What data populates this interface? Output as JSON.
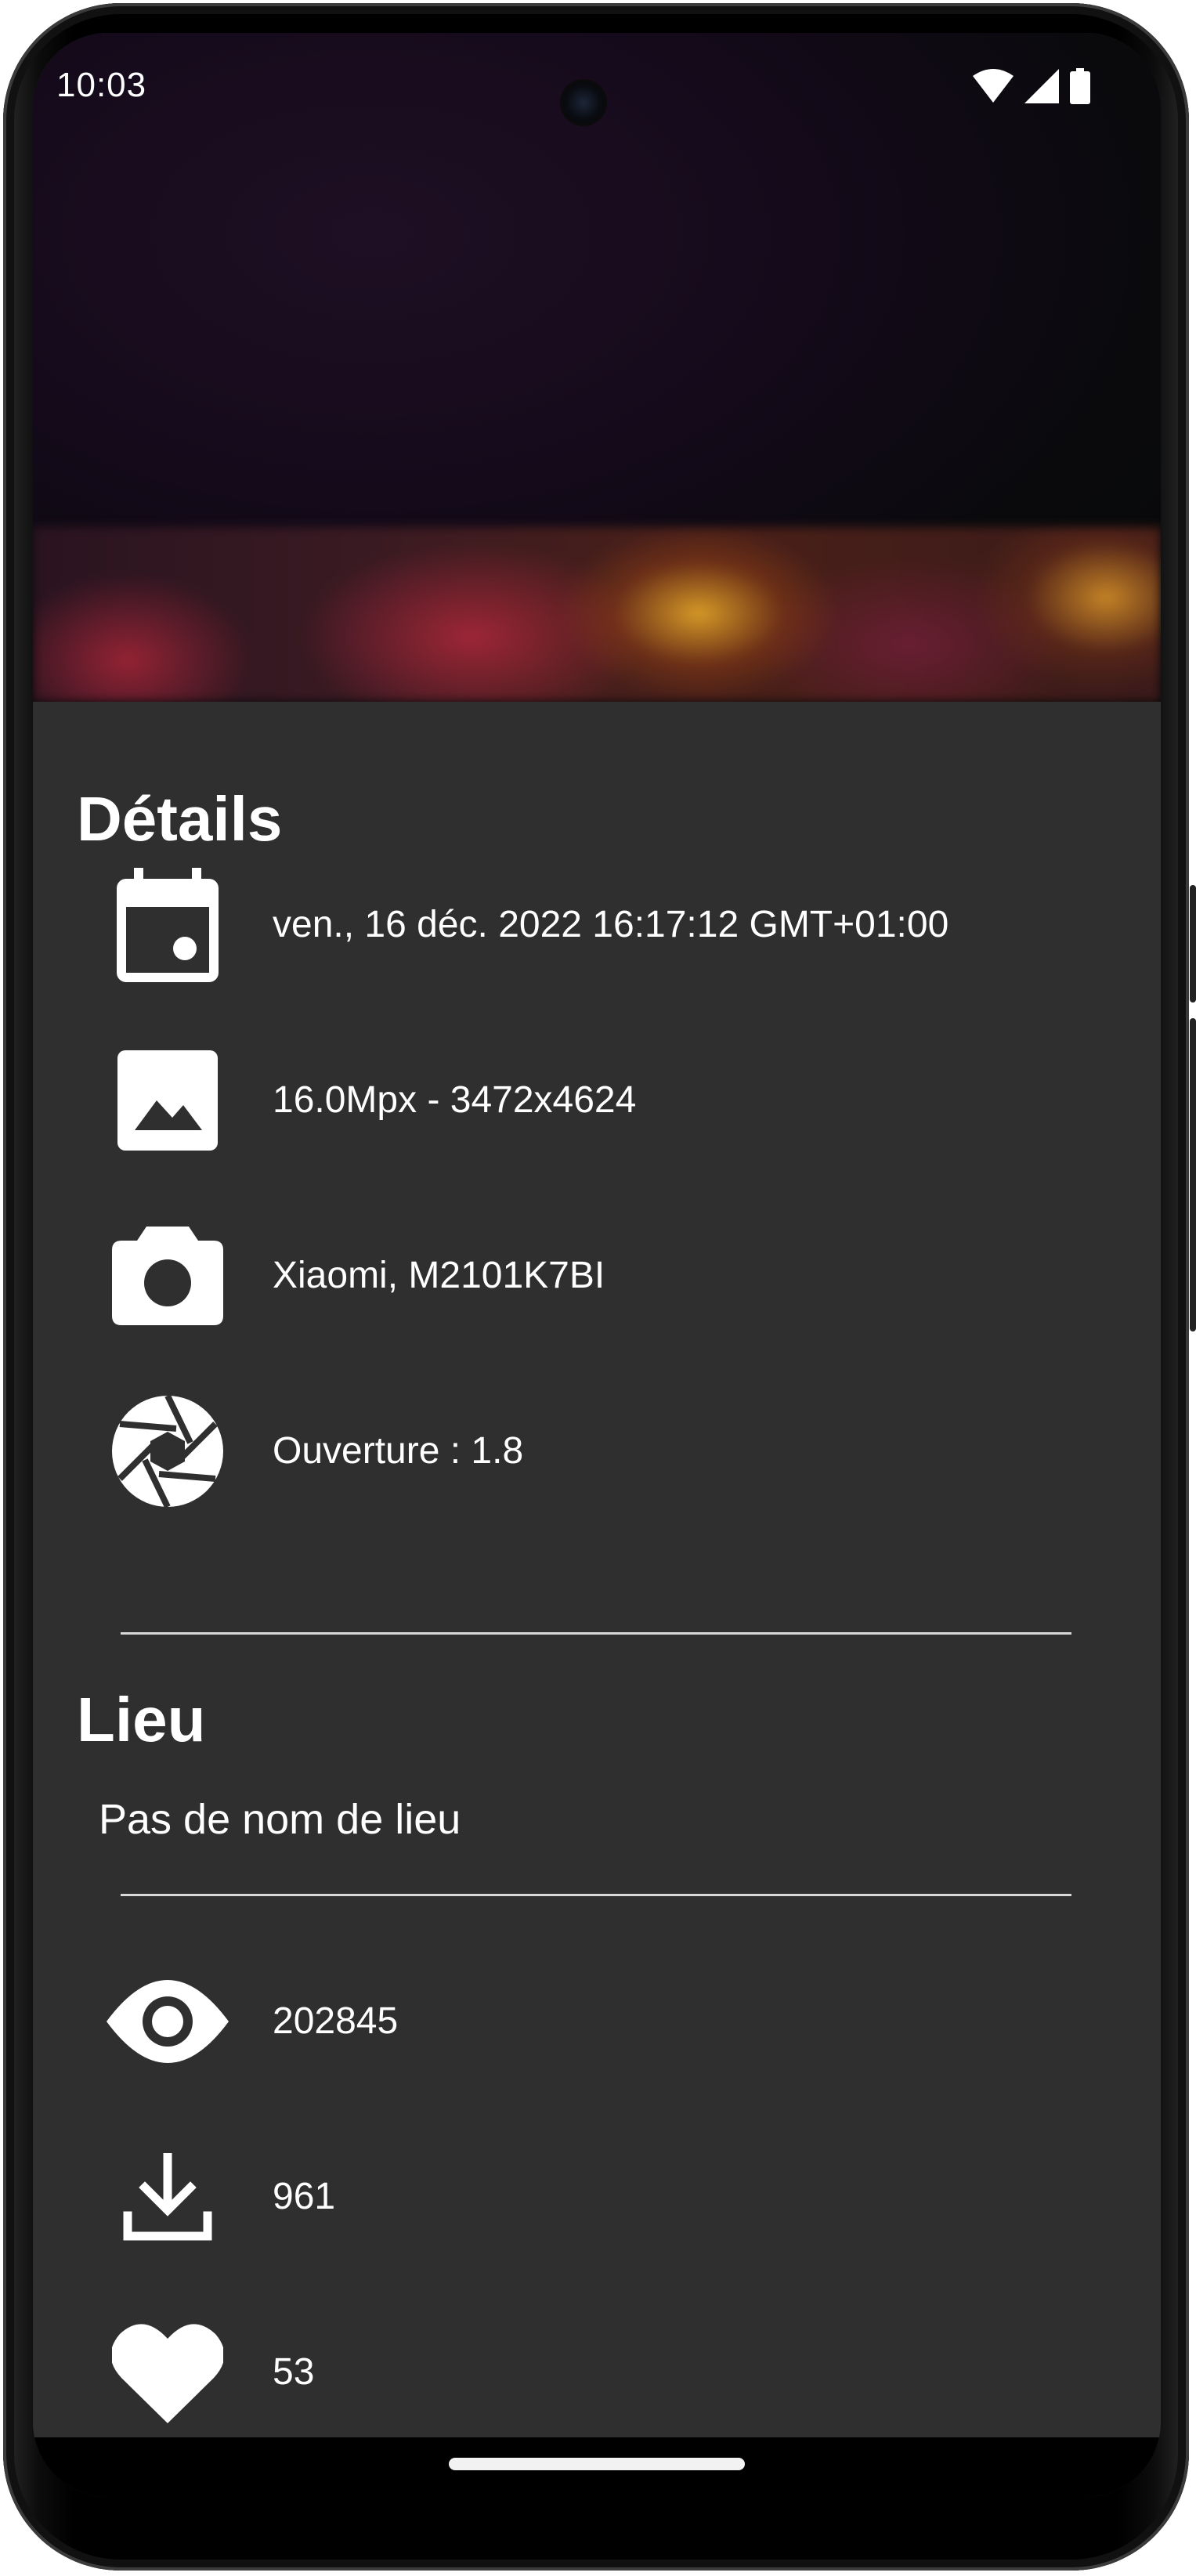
{
  "status_bar": {
    "time": "10:03",
    "icons": [
      "wifi-icon",
      "cell-signal-icon",
      "battery-icon"
    ]
  },
  "details": {
    "title": "Détails",
    "items": [
      {
        "icon": "calendar-icon",
        "text": "ven., 16 déc. 2022 16:17:12 GMT+01:00"
      },
      {
        "icon": "image-icon",
        "text": "16.0Mpx  -  3472x4624"
      },
      {
        "icon": "camera-icon",
        "text": "Xiaomi, M2101K7BI"
      },
      {
        "icon": "aperture-icon",
        "text": "Ouverture : 1.8"
      }
    ]
  },
  "location": {
    "title": "Lieu",
    "text": "Pas de nom de lieu"
  },
  "stats": {
    "items": [
      {
        "icon": "eye-icon",
        "text": "202845"
      },
      {
        "icon": "download-icon",
        "text": "961"
      },
      {
        "icon": "heart-icon",
        "text": "53"
      }
    ]
  },
  "colors": {
    "sheet_background": "#2f2f2f",
    "text": "#ffffff",
    "divider": "#d9d9d9",
    "nav_bar": "#000000"
  }
}
